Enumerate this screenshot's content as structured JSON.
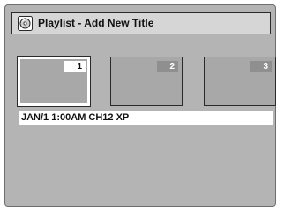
{
  "window": {
    "title": "Playlist - Add New Title",
    "icon": "disc-icon"
  },
  "thumbnails": [
    {
      "number": "1",
      "selected": true
    },
    {
      "number": "2",
      "selected": false
    },
    {
      "number": "3",
      "selected": false
    }
  ],
  "info": {
    "text": "JAN/1 1:00AM CH12 XP"
  },
  "colors": {
    "screen_bg": "#b4b4b4",
    "title_bg": "#d6d6d6",
    "thumb_bg": "#a8a8a8",
    "number_badge": "#8f8f8f",
    "highlight": "#ffffff"
  }
}
